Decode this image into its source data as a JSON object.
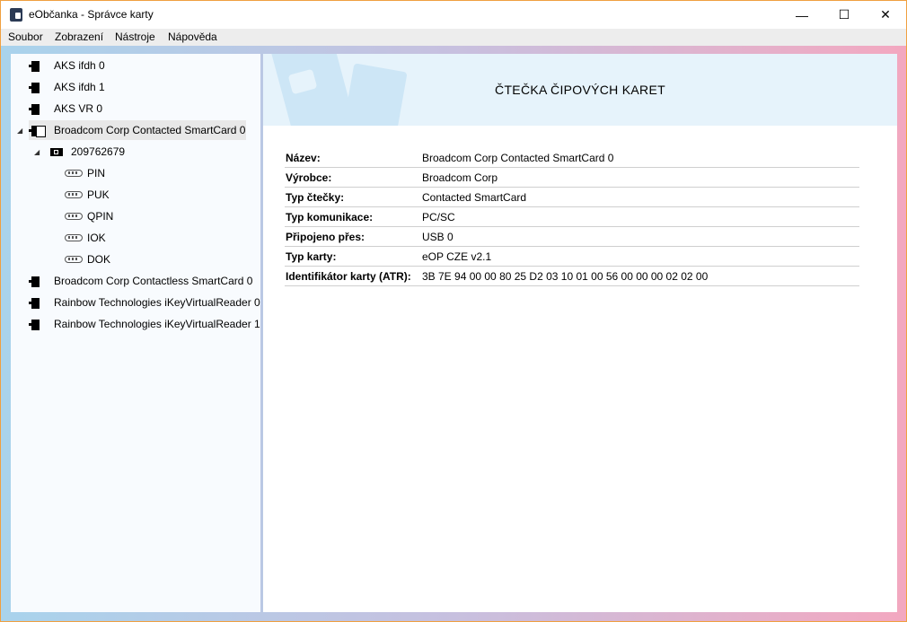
{
  "window": {
    "title": "eObčanka - Správce karty"
  },
  "controls": {
    "minimize": "—",
    "maximize": "☐",
    "close": "✕"
  },
  "menu": [
    "Soubor",
    "Zobrazení",
    "Nástroje",
    "Nápověda"
  ],
  "tree": [
    {
      "label": "AKS ifdh 0",
      "icon": "reader-icon"
    },
    {
      "label": "AKS ifdh 1",
      "icon": "reader-icon"
    },
    {
      "label": "AKS VR 0",
      "icon": "reader-icon"
    },
    {
      "label": "Broadcom Corp Contacted SmartCard 0",
      "icon": "reader-with-card-icon",
      "expanded": true,
      "selected": true
    },
    {
      "label": "209762679",
      "icon": "chip-card-icon",
      "expanded": true
    },
    {
      "label": "PIN",
      "icon": "key-icon"
    },
    {
      "label": "PUK",
      "icon": "key-icon"
    },
    {
      "label": "QPIN",
      "icon": "key-icon"
    },
    {
      "label": "IOK",
      "icon": "key-icon"
    },
    {
      "label": "DOK",
      "icon": "key-icon"
    },
    {
      "label": "Broadcom Corp Contactless SmartCard 0",
      "icon": "reader-icon"
    },
    {
      "label": "Rainbow Technologies iKeyVirtualReader 0",
      "icon": "reader-icon"
    },
    {
      "label": "Rainbow Technologies iKeyVirtualReader 1",
      "icon": "reader-icon"
    }
  ],
  "main": {
    "title": "ČTEČKA ČIPOVÝCH KARET",
    "properties": [
      {
        "label": "Název:",
        "value": "Broadcom Corp Contacted SmartCard 0"
      },
      {
        "label": "Výrobce:",
        "value": "Broadcom Corp"
      },
      {
        "label": "Typ čtečky:",
        "value": "Contacted SmartCard"
      },
      {
        "label": "Typ komunikace:",
        "value": "PC/SC"
      },
      {
        "label": "Připojeno přes:",
        "value": "USB 0"
      },
      {
        "label": "Typ karty:",
        "value": "eOP CZE v2.1"
      },
      {
        "label": "Identifikátor karty (ATR):",
        "value": "3B 7E 94 00 00 80 25 D2 03 10 01 00 56 00 00 00 02 02 00"
      }
    ]
  },
  "colors": {
    "window_border": "#f0a040",
    "header_band": "#e6f3fb",
    "selection": "#e8e8e8"
  }
}
